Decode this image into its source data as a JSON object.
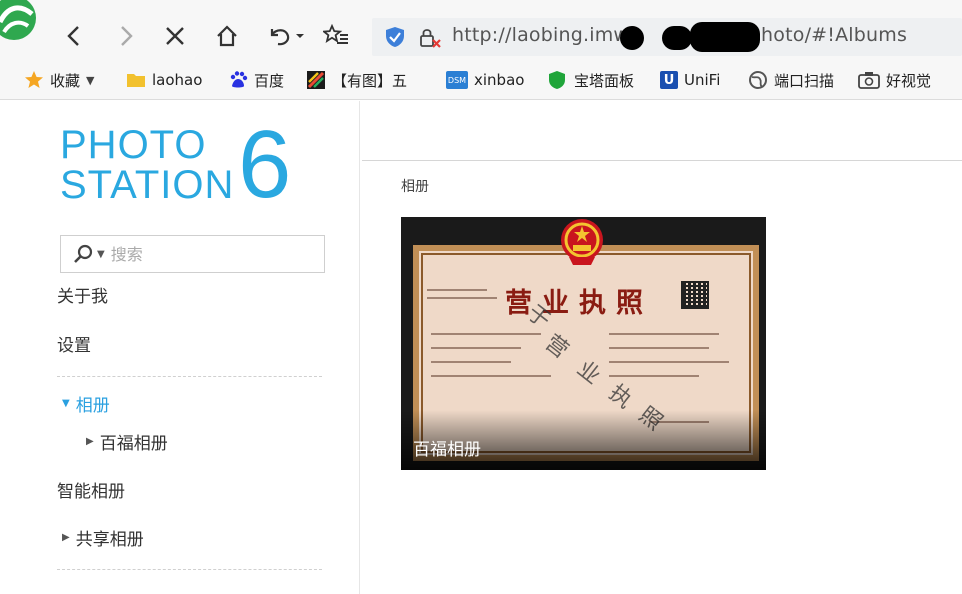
{
  "browser": {
    "url_prefix": "http://laobing.imw",
    "url_suffix": "/photo/#!Albums"
  },
  "bookmarks": [
    {
      "label": "收藏",
      "icon": "star-icon",
      "color": "#f5a623"
    },
    {
      "label": "laohao",
      "icon": "folder-icon",
      "color": "#f2c12e"
    },
    {
      "label": "百度",
      "icon": "baidu-paw-icon",
      "color": "#2932e1"
    },
    {
      "label": "【有图】五",
      "icon": "colorful-square-icon",
      "color": "#e94b35"
    },
    {
      "label": "xinbao",
      "icon": "dsm-icon",
      "color": "#2a7fd4",
      "icon_text": "DSM"
    },
    {
      "label": "宝塔面板",
      "icon": "shield-leaf-icon",
      "color": "#20a53a"
    },
    {
      "label": "UniFi",
      "icon": "unifi-icon",
      "color": "#1a4fb0",
      "icon_text": "U"
    },
    {
      "label": "端口扫描",
      "icon": "globe-icon",
      "color": "#555555"
    },
    {
      "label": "好视觉",
      "icon": "camera-icon",
      "color": "#555555"
    }
  ],
  "app": {
    "logo_word1": "PHOTO",
    "logo_word2": "STATION",
    "logo_number": "6",
    "accent": "#2aa8e0"
  },
  "search": {
    "placeholder": "搜索"
  },
  "sidebar": {
    "about": "关于我",
    "settings": "设置",
    "albums": "相册",
    "sub_album": "百福相册",
    "smart_albums": "智能相册",
    "shared_albums": "共享相册"
  },
  "main": {
    "breadcrumb": "相册",
    "albums": [
      {
        "label": "百福相册",
        "cover_title": "营业执照",
        "cover_watermark": [
          "于",
          "营",
          "业",
          "执",
          "照"
        ]
      }
    ]
  }
}
